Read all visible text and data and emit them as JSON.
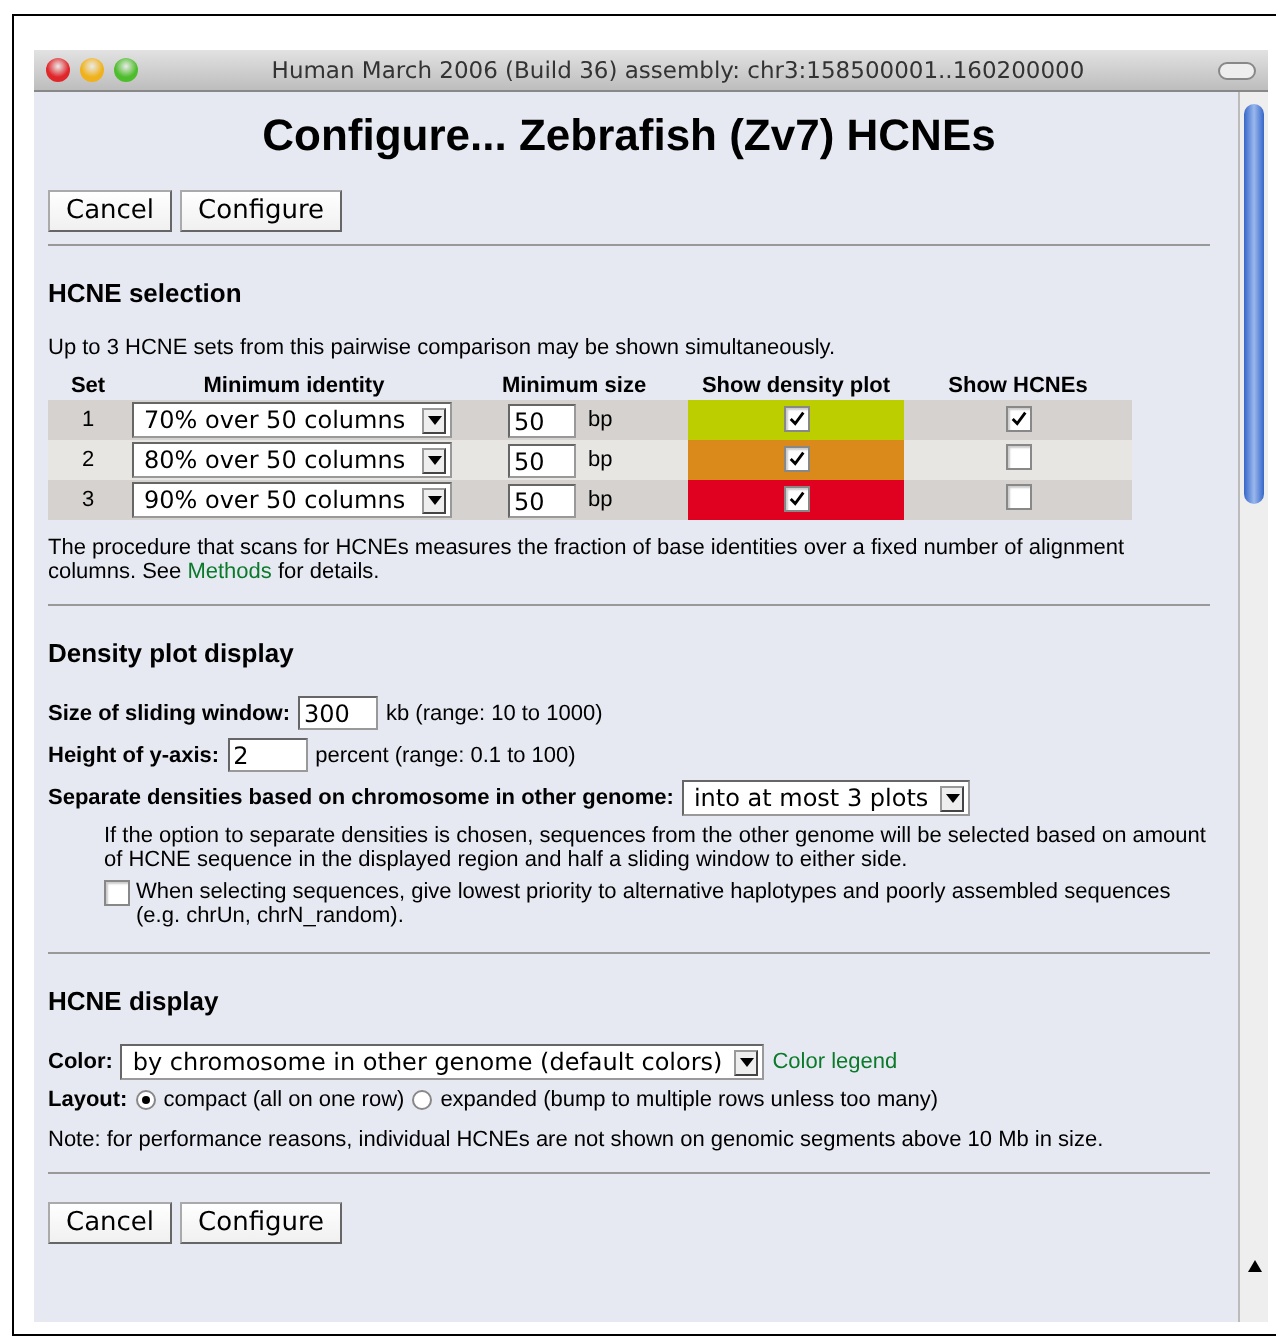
{
  "window": {
    "title": "Human March 2006 (Build 36) assembly: chr3:158500001..160200000"
  },
  "heading": "Configure... Zebrafish (Zv7) HCNEs",
  "top_buttons": [
    "Cancel",
    "Configure"
  ],
  "hcne_selection": {
    "title": "HCNE selection",
    "intro": "Up to 3 HCNE sets from this pairwise comparison may be shown simultaneously.",
    "columns": [
      "Set",
      "Minimum identity",
      "Minimum size",
      "Show density plot",
      "Show HCNEs"
    ],
    "rows": [
      {
        "set": "1",
        "identity": "70% over 50 columns",
        "size": "50",
        "unit": "bp",
        "color": "#bccd00",
        "density": true,
        "show": true
      },
      {
        "set": "2",
        "identity": "80% over 50 columns",
        "size": "50",
        "unit": "bp",
        "color": "#d98a1a",
        "density": true,
        "show": false
      },
      {
        "set": "3",
        "identity": "90% over 50 columns",
        "size": "50",
        "unit": "bp",
        "color": "#e0001f",
        "density": true,
        "show": false
      }
    ],
    "note_text": "The procedure that scans for HCNEs measures the fraction of base identities over a fixed number of alignment columns. See",
    "note_link": "Methods",
    "note_end": "for details."
  },
  "density": {
    "title": "Density plot display",
    "window_label": "Size of sliding window:",
    "window_value": "300",
    "window_unit": "kb (range: 10 to 1000)",
    "yaxis_label": "Height of y-axis:",
    "yaxis_value": "2",
    "yaxis_unit": "percent (range: 0.1 to 100)",
    "separate_label": "Separate densities based on chromosome in other genome:",
    "separate_value": "into at most 3 plots",
    "explanation": "If the option to separate densities is chosen, sequences from the other genome will be selected based on amount of HCNE sequence in the displayed region and half a sliding window to either side.",
    "low_priority": {
      "checked": false,
      "label": "When selecting sequences, give lowest priority to alternative haplotypes and poorly assembled sequences (e.g. chrUn, chrN_random)."
    }
  },
  "display": {
    "title": "HCNE display",
    "color_label": "Color:",
    "color_value": "by chromosome in other genome (default colors)",
    "legend_link": "Color legend",
    "layout_label": "Layout:",
    "layout_options": [
      {
        "label": "compact (all on one row)",
        "selected": true
      },
      {
        "label": "expanded (bump to multiple rows unless too many)",
        "selected": false
      }
    ],
    "note": "Note: for performance reasons, individual HCNEs are not shown on genomic segments above 10 Mb in size."
  },
  "bottom_buttons": [
    "Cancel",
    "Configure"
  ]
}
